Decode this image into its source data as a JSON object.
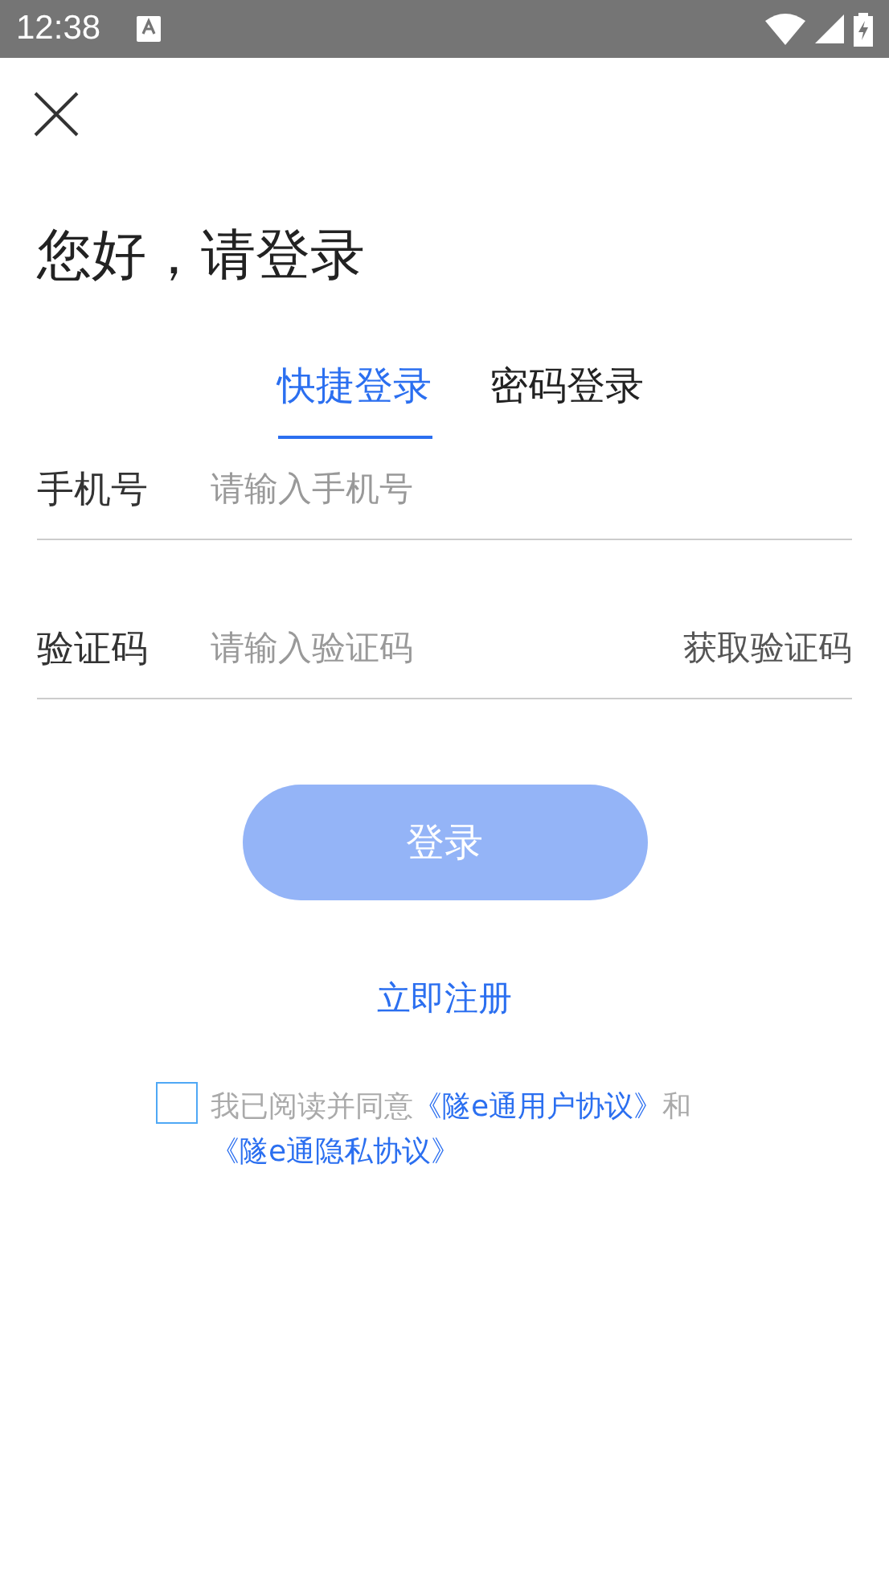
{
  "status_bar": {
    "time": "12:38"
  },
  "title": "您好，请登录",
  "tabs": [
    {
      "label": "快捷登录",
      "selected": true
    },
    {
      "label": "密码登录",
      "selected": false
    }
  ],
  "fields": [
    {
      "label": "手机号",
      "placeholder": "请输入手机号"
    },
    {
      "label": "验证码",
      "placeholder": "请输入验证码",
      "action": "获取验证码"
    }
  ],
  "login_button": {
    "label": "登录",
    "disabled": true
  },
  "register_link": "立即注册",
  "agreement": {
    "checked": false,
    "prefix": "我已阅读并同意",
    "link1": "《隧e通用户协议》",
    "middle": "和",
    "link2": "《隧e通隐私协议》"
  }
}
